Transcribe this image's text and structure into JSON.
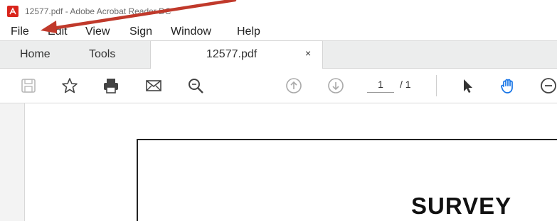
{
  "window": {
    "title": "12577.pdf - Adobe Acrobat Reader DC"
  },
  "menu": {
    "items": [
      "File",
      "Edit",
      "View",
      "Sign",
      "Window",
      "Help"
    ]
  },
  "tabs": {
    "home": "Home",
    "tools": "Tools",
    "document": "12577.pdf",
    "close_glyph": "×"
  },
  "toolbar": {
    "icons": [
      "save-icon",
      "star-icon",
      "print-icon",
      "email-icon",
      "zoom-search-icon",
      "page-up-icon",
      "page-down-icon",
      "select-arrow-icon",
      "hand-icon",
      "zoom-out-icon"
    ],
    "current_page": "1",
    "total_pages": "/ 1",
    "accent_color": "#1473e6"
  },
  "document": {
    "heading": "SURVEY"
  },
  "annotation": {
    "arrow_color": "#c0392b"
  }
}
